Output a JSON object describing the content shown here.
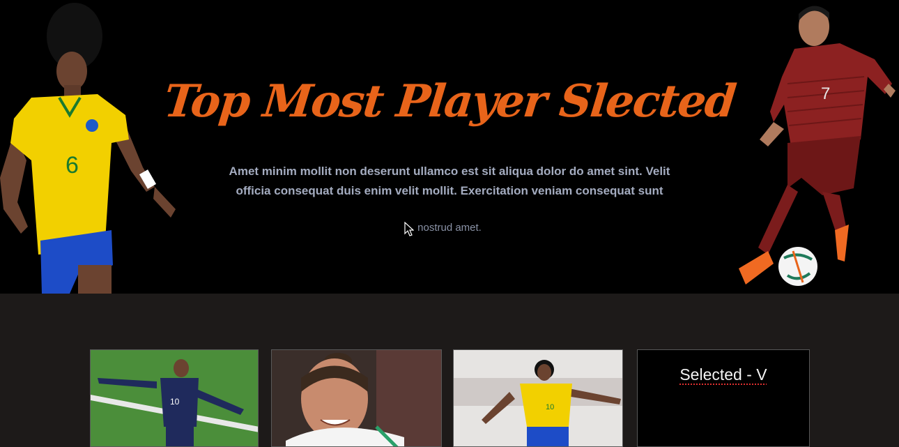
{
  "hero": {
    "title": "Top Most Player Slected",
    "description": "Amet minim mollit non deserunt ullamco est sit aliqua dolor do amet sint. Velit officia consequat duis enim velit mollit. Exercitation veniam consequat sunt",
    "note": "nostrud amet.",
    "left_player": {
      "jersey_number": "6",
      "icon": "player-brazil-image"
    },
    "right_player": {
      "jersey_number": "7",
      "icon": "player-portugal-image"
    }
  },
  "cards": [
    {
      "icon": "player-france-photo",
      "jersey_number": "10"
    },
    {
      "icon": "player-portrait-photo"
    },
    {
      "icon": "player-brazil-photo",
      "jersey_number": "10"
    }
  ],
  "selected": {
    "label": "Selected - V"
  },
  "colors": {
    "accent": "#e8641a",
    "hero_bg": "#000000",
    "section_bg": "#1d1a19",
    "text_muted": "#a4acc0"
  }
}
